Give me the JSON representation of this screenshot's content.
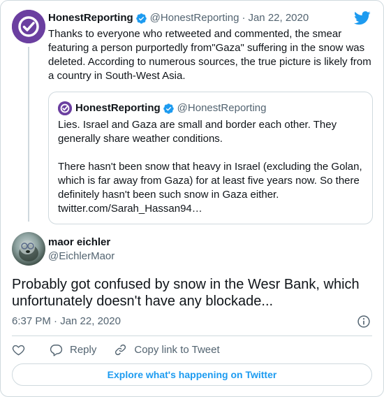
{
  "colors": {
    "accent": "#1d9bf0",
    "muted": "#536471",
    "border": "#cfd9de",
    "text": "#0f1419",
    "brand_avatar": "#6b3fa0"
  },
  "parent_tweet": {
    "name": "HonestReporting",
    "handle": "@HonestReporting",
    "separator": "·",
    "date": "Jan 22, 2020",
    "text": "Thanks to everyone who retweeted and commented, the smear featuring a person purportedly from\"Gaza\" suffering in the snow was deleted. According to numerous sources, the true picture is likely from a country in South-West Asia."
  },
  "quoted_tweet": {
    "name": "HonestReporting",
    "handle": "@HonestReporting",
    "paragraph_1": "Lies. Israel and Gaza are small and border each other. They generally share weather conditions.",
    "paragraph_2": "There hasn't been snow that heavy in Israel (excluding the Golan, which is far away from Gaza) for at least five years now. So there definitely hasn't been such snow in Gaza either. twitter.com/Sarah_Hassan94…"
  },
  "main_tweet": {
    "name": "maor eichler",
    "handle": "@EichlerMaor",
    "text": "Probably got confused by snow in the Wesr Bank, which unfortunately doesn't have any blockade...",
    "time": "6:37 PM · Jan 22, 2020"
  },
  "actions": {
    "reply_label": "Reply",
    "copy_link_label": "Copy link to Tweet"
  },
  "explore_label": "Explore what's happening on Twitter",
  "icons": [
    "verified-badge-icon",
    "twitter-bird-icon",
    "info-icon",
    "heart-icon",
    "reply-icon",
    "link-icon"
  ]
}
